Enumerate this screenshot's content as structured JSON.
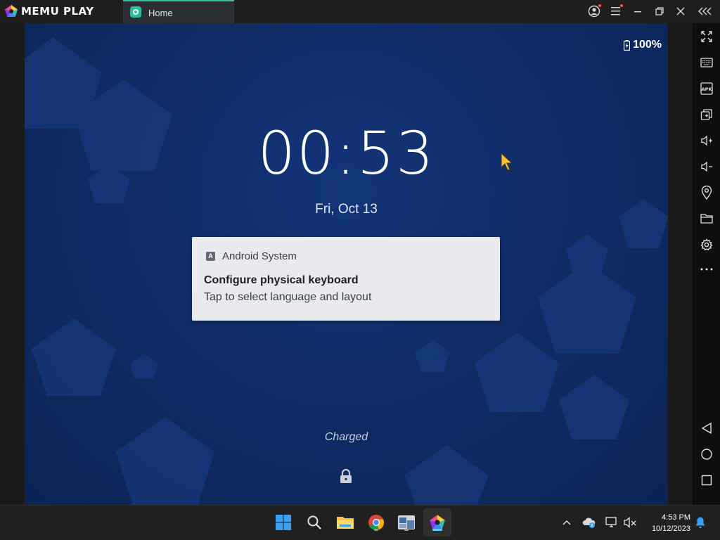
{
  "titlebar": {
    "brand": "MEMU PLAY",
    "tab_label": "Home",
    "accent": "#36c1a2"
  },
  "status_bar": {
    "battery": "100%"
  },
  "lockscreen": {
    "clock": "00:53",
    "date": "Fri, Oct 13",
    "charging_status": "Charged"
  },
  "notification": {
    "app_icon_letter": "A",
    "app_name": "Android System",
    "title": "Configure physical keyboard",
    "text": "Tap to select language and layout"
  },
  "sidebar": {
    "items": [
      "fullscreen-icon",
      "keyboard-icon",
      "apk-icon",
      "multi-instance-icon",
      "volume-up-icon",
      "volume-down-icon",
      "location-icon",
      "folder-icon",
      "settings-icon",
      "more-icon",
      "back-icon",
      "home-icon",
      "recents-icon"
    ]
  },
  "taskbar": {
    "apps": [
      "windows-start-icon",
      "search-icon",
      "file-explorer-icon",
      "chrome-icon",
      "app-icon",
      "memu-icon"
    ],
    "clock_time": "4:53 PM",
    "clock_date": "10/12/2023"
  }
}
